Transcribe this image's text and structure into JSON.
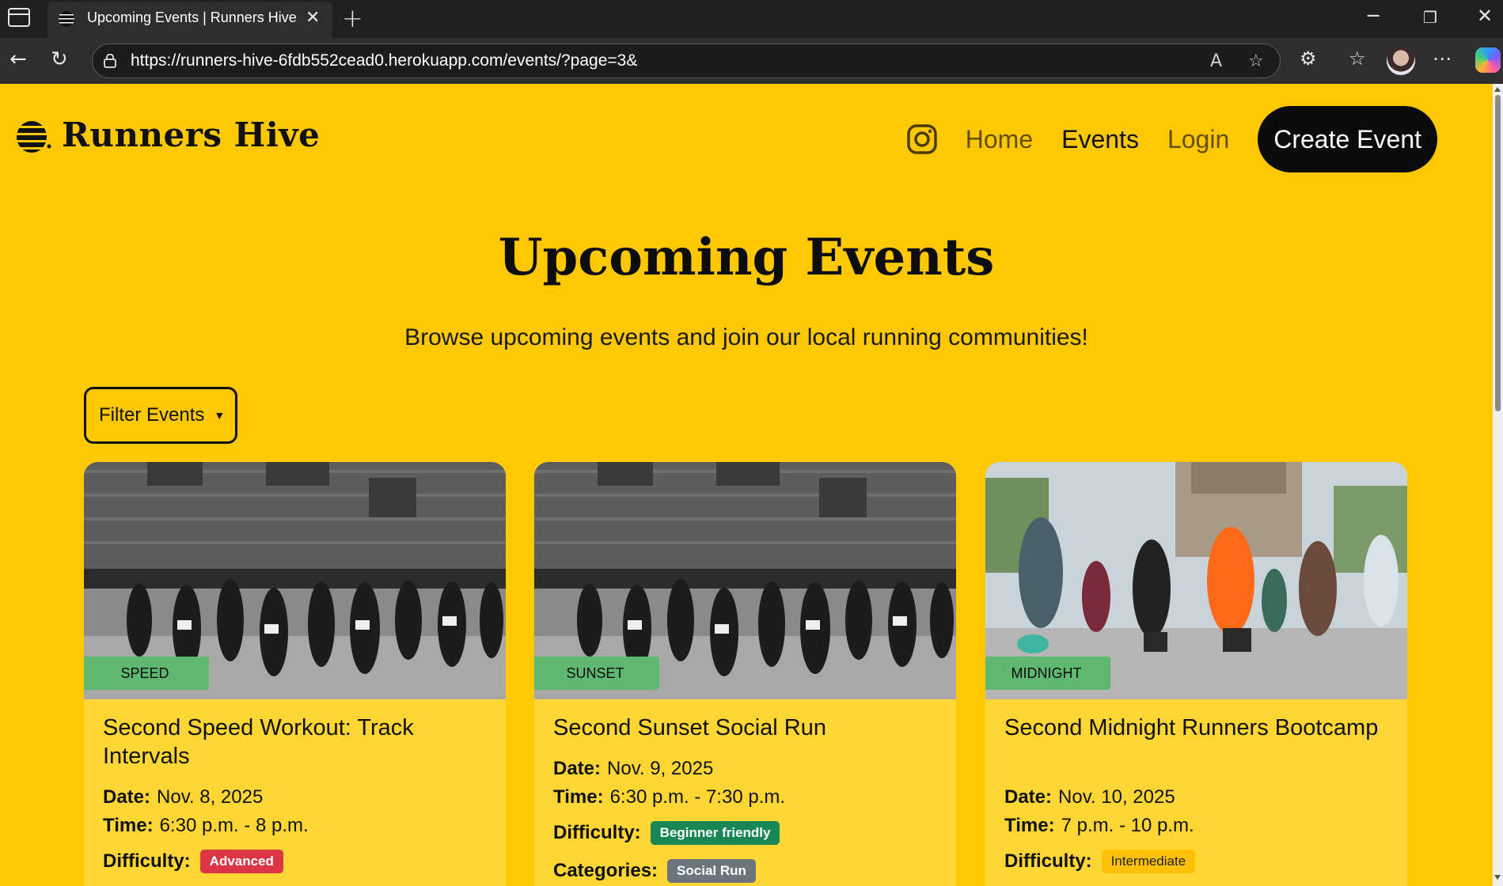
{
  "browser": {
    "tab_title": "Upcoming Events | Runners Hive",
    "url": "https://runners-hive-6fdb552cead0.herokuapp.com/events/?page=3&"
  },
  "site": {
    "brand": "Runners Hive",
    "nav": {
      "home": "Home",
      "events": "Events",
      "login": "Login",
      "create_event": "Create Event"
    }
  },
  "page": {
    "title": "Upcoming Events",
    "subtitle": "Browse upcoming events and join our local running communities!",
    "filter_label": "Filter Events"
  },
  "labels": {
    "date": "Date:",
    "time": "Time:",
    "difficulty": "Difficulty:",
    "categories": "Categories:"
  },
  "events": [
    {
      "tag": "SPEED",
      "title": "Second Speed Workout: Track Intervals",
      "date": "Nov. 8, 2025",
      "time": "6:30 p.m. - 8 p.m.",
      "difficulty": "Advanced"
    },
    {
      "tag": "SUNSET",
      "title": "Second Sunset Social Run",
      "date": "Nov. 9, 2025",
      "time": "6:30 p.m. - 7:30 p.m.",
      "difficulty": "Beginner friendly",
      "category": "Social Run"
    },
    {
      "tag": "MIDNIGHT",
      "title": "Second Midnight Runners Bootcamp",
      "date": "Nov. 10, 2025",
      "time": "7 p.m. - 10 p.m.",
      "difficulty": "Intermediate"
    }
  ],
  "colors": {
    "page_bg": "#ffc800",
    "card_bg": "#ffd633",
    "tag_bg": "#5fb86f",
    "advanced": "#dc3545",
    "beginner": "#198754",
    "intermediate": "#ffc107",
    "category": "#6c757d"
  },
  "icons": {
    "instagram": "instagram-icon",
    "logo": "beehive-icon"
  }
}
